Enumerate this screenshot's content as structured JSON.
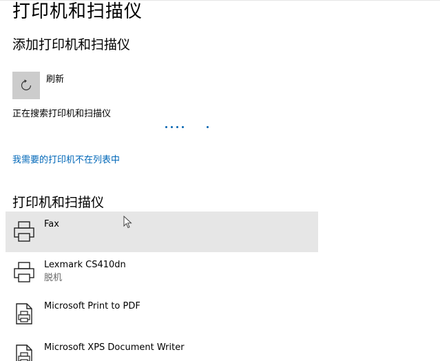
{
  "page": {
    "title": "打印机和扫描仪"
  },
  "add_section": {
    "title": "添加打印机和扫描仪",
    "refresh_label": "刷新",
    "searching_text": "正在搜索打印机和扫描仪",
    "missing_link": "我需要的打印机不在列表中"
  },
  "devices_section": {
    "title": "打印机和扫描仪",
    "items": [
      {
        "name": "Fax",
        "status": "",
        "icon": "printer-icon"
      },
      {
        "name": "Lexmark CS410dn",
        "status": "脱机",
        "icon": "printer-icon"
      },
      {
        "name": "Microsoft Print to PDF",
        "status": "",
        "icon": "document-printer-icon"
      },
      {
        "name": "Microsoft XPS Document Writer",
        "status": "",
        "icon": "document-printer-icon"
      }
    ]
  },
  "colors": {
    "accent": "#0067b8",
    "selected_row": "#e6e6e6",
    "refresh_button": "#cccccc"
  }
}
